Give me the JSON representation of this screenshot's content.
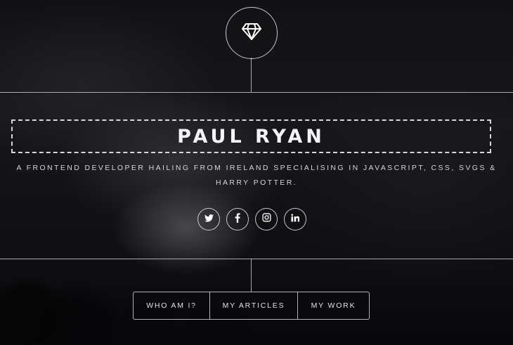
{
  "logo": {
    "icon": "diamond-icon"
  },
  "hero": {
    "title": "PAUL RYAN",
    "tagline": "A FRONTEND DEVELOPER HAILING FROM IRELAND SPECIALISING IN JAVASCRIPT, CSS, SVGS & HARRY POTTER."
  },
  "social": [
    {
      "name": "twitter",
      "icon": "twitter-icon"
    },
    {
      "name": "facebook",
      "icon": "facebook-icon"
    },
    {
      "name": "instagram",
      "icon": "instagram-icon"
    },
    {
      "name": "linkedin",
      "icon": "linkedin-icon"
    }
  ],
  "nav": {
    "items": [
      {
        "label": "WHO AM I?"
      },
      {
        "label": "MY ARTICLES"
      },
      {
        "label": "MY WORK"
      }
    ]
  },
  "colors": {
    "background": "#0d0d10",
    "lines": "#dcdce1",
    "text": "#ffffff"
  }
}
